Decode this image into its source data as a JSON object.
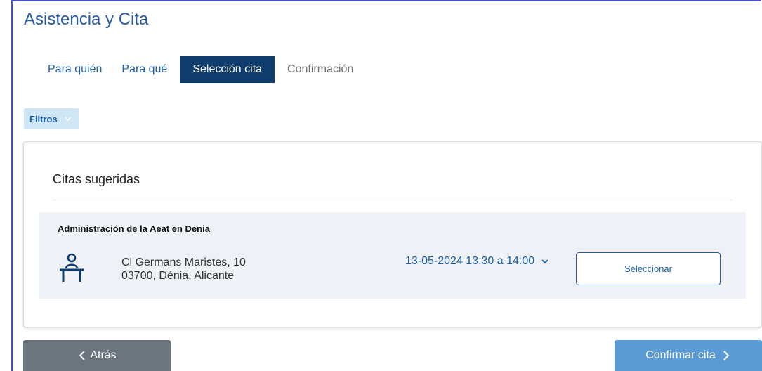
{
  "page": {
    "title": "Asistencia y Cita"
  },
  "tabs": [
    {
      "label": "Para quién",
      "state": "link"
    },
    {
      "label": "Para qué",
      "state": "link"
    },
    {
      "label": "Selección cita",
      "state": "active"
    },
    {
      "label": "Confirmación",
      "state": "disabled"
    }
  ],
  "filters": {
    "label": "Filtros",
    "icon": "chevron-down-icon"
  },
  "suggested": {
    "title": "Citas sugeridas",
    "office": {
      "name": "Administración de la Aeat en Denia",
      "icon": "office-desk-person-icon",
      "address_line1": "Cl Germans Maristes, 10",
      "address_line2": "03700, Dénia, Alicante",
      "time_slot": "13-05-2024 13:30 a 14:00",
      "select_label": "Seleccionar"
    }
  },
  "footer": {
    "back_label": "Atrás",
    "confirm_label": "Confirmar cita"
  },
  "colors": {
    "primary": "#1f5fa8",
    "active_tab_bg": "#0f3d6e",
    "back_button_bg": "#6c757d",
    "confirm_button_bg": "#5a9bd5",
    "filter_chip_bg": "#cfe6f7",
    "office_row_bg": "#eef2f6"
  }
}
